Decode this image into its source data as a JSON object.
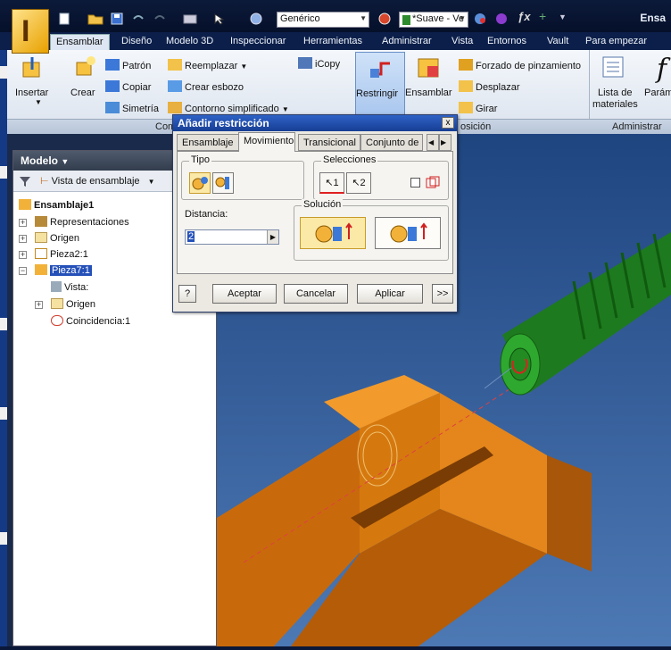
{
  "qat": {
    "material": "Genérico",
    "appearance": "*Suave - Ve",
    "title": "Ensa"
  },
  "tabs": [
    "Ensamblar",
    "Diseño",
    "Modelo 3D",
    "Inspeccionar",
    "Herramientas",
    "Administrar",
    "Vista",
    "Entornos",
    "Vault",
    "Para empezar"
  ],
  "ribbon": {
    "insertar": "Insertar",
    "crear": "Crear",
    "patron": "Patrón",
    "copiar": "Copiar",
    "simetria": "Simetría",
    "reemplazar": "Reemplazar",
    "crear_esbozo": "Crear esbozo",
    "contorno": "Contorno simplificado",
    "icopy": "iCopy",
    "restringir": "Restringir",
    "ensamblar": "Ensamblar",
    "forzado": "Forzado de pinzamiento",
    "desplazar": "Desplazar",
    "girar": "Girar",
    "lista_mat_1": "Lista de",
    "lista_mat_2": "materiales",
    "param": "Parám",
    "panel_com": "Com",
    "panel_posicion": "osición",
    "panel_admin": "Administrar"
  },
  "browser": {
    "title": "Modelo",
    "view": "Vista de ensamblaje",
    "tree": [
      "Ensamblaje1",
      "Representaciones",
      "Origen",
      "Pieza2:1",
      "Pieza7:1",
      "Vista:",
      "Origen",
      "Coincidencia:1"
    ]
  },
  "dialog": {
    "title": "Añadir restricción",
    "close": "x",
    "tabs": [
      "Ensamblaje",
      "Movimiento",
      "Transicional",
      "Conjunto de r"
    ],
    "tipo": "Tipo",
    "selecciones": "Selecciones",
    "sel1": "1",
    "sel2": "2",
    "distancia": "Distancia:",
    "distancia_value": "2",
    "solucion": "Solución",
    "help": "?",
    "aceptar": "Aceptar",
    "cancelar": "Cancelar",
    "aplicar": "Aplicar",
    "more": ">>"
  },
  "colors": {
    "orange_part": "#e07a10",
    "green_part": "#2e9a2e",
    "viewport_bg": "#2b5390",
    "ribbon_tab_bg": "#0c1f4a",
    "selection": "#2450b8"
  }
}
